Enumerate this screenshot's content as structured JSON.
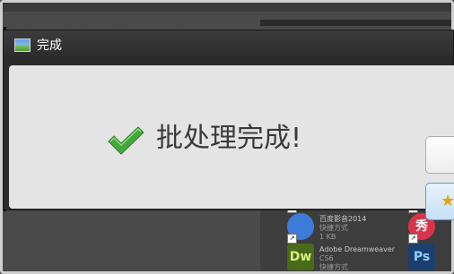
{
  "dialog": {
    "title": "完成",
    "message": "批处理完成!",
    "title_icon": "image-icon",
    "status_icon": "checkmark-icon",
    "check_color": "#43a83a"
  },
  "desktop": {
    "tiles": [
      {
        "icon_text": "",
        "name": "百度影音2014",
        "sub1": "快捷方式",
        "sub2": "1 KB",
        "color": "#3d7bd8"
      },
      {
        "icon_text": "秀",
        "name": "",
        "sub1": "",
        "sub2": "",
        "color": "#d8344a"
      },
      {
        "icon_text": "Dw",
        "name": "Adobe Dreamweaver",
        "sub1": "CS6",
        "sub2": "快捷方式",
        "color": "#4a6a1a"
      },
      {
        "icon_text": "Ps",
        "name": "",
        "sub1": "",
        "sub2": "",
        "color": "#1c3f6e"
      }
    ]
  }
}
